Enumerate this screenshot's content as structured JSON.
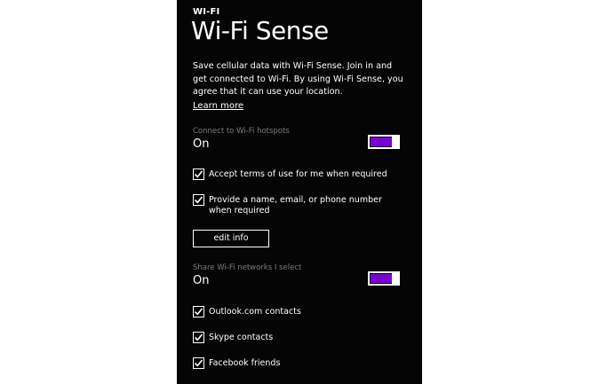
{
  "header": {
    "section": "WI-FI",
    "title": "Wi-Fi Sense"
  },
  "description": "Save cellular data with Wi-Fi Sense. Join in and get connected to Wi-Fi. By using Wi-Fi Sense, you agree that it can use your location.",
  "learn_more": "Learn more",
  "hotspots": {
    "label": "Connect to Wi-Fi hotspots",
    "value": "On",
    "on": true
  },
  "hotspot_options": [
    {
      "label": "Accept terms of use for me when required",
      "checked": true
    },
    {
      "label": "Provide a name, email, or phone number when required",
      "checked": true
    }
  ],
  "edit_info": "edit info",
  "share": {
    "label": "Share Wi-Fi networks I select",
    "value": "On",
    "on": true
  },
  "share_options": [
    {
      "label": "Outlook.com contacts",
      "checked": true
    },
    {
      "label": "Skype contacts",
      "checked": true
    },
    {
      "label": "Facebook friends",
      "checked": true
    }
  ],
  "colors": {
    "accent": "#7b00d8",
    "background": "#050505",
    "foreground": "#ffffff",
    "subtle": "#7a7a7a"
  }
}
